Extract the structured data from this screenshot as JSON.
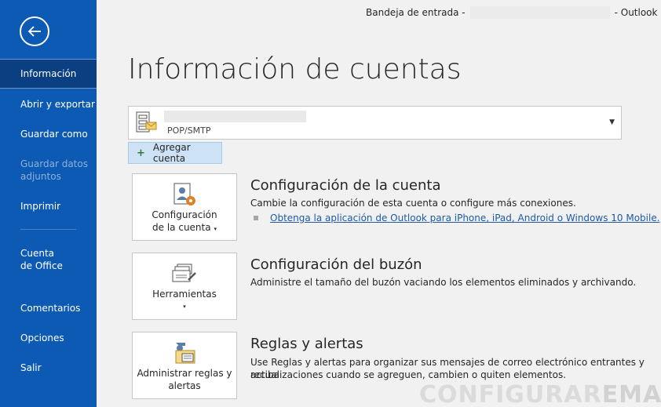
{
  "window": {
    "title_prefix": "Bandeja de entrada -",
    "title_suffix": "- Outlook"
  },
  "sidebar": {
    "items": [
      {
        "label": "Información",
        "active": true
      },
      {
        "label": "Abrir y exportar"
      },
      {
        "label": "Guardar como"
      },
      {
        "label": "Guardar datos adjuntos",
        "disabled": true
      },
      {
        "label": "Imprimir"
      },
      {
        "label": "Cuenta de Office"
      },
      {
        "label": "Comentarios"
      },
      {
        "label": "Opciones"
      },
      {
        "label": "Salir"
      }
    ]
  },
  "main": {
    "title": "Información de cuentas",
    "account": {
      "type": "POP/SMTP"
    },
    "add_account_label": "Agregar cuenta",
    "sections": [
      {
        "button_label_line1": "Configuración",
        "button_label_line2": "de la cuenta",
        "title": "Configuración de la cuenta",
        "description": "Cambie la configuración de esta cuenta o configure más conexiones.",
        "link": "Obtenga la aplicación de Outlook para iPhone, iPad, Android o Windows 10 Mobile."
      },
      {
        "button_label_line1": "Herramientas",
        "title": "Configuración del buzón",
        "description": "Administre el tamaño del buzón vaciando los elementos eliminados y archivando."
      },
      {
        "button_label_line1": "Administrar reglas y",
        "button_label_line2": "alertas",
        "title": "Reglas y alertas",
        "description_line1": "Use Reglas y alertas para organizar sus mensajes de correo electrónico entrantes y reciba",
        "description_line2": "actualizaciones cuando se agreguen, cambien o quiten elementos."
      }
    ]
  },
  "watermark": {
    "part1": "CONFIGURAR",
    "part2": "EMAIL"
  },
  "colors": {
    "sidebar": "#0d5ab5",
    "sidebar_active": "#0a3f82",
    "link": "#1f5aa6",
    "add_button": "#cde3f5"
  }
}
